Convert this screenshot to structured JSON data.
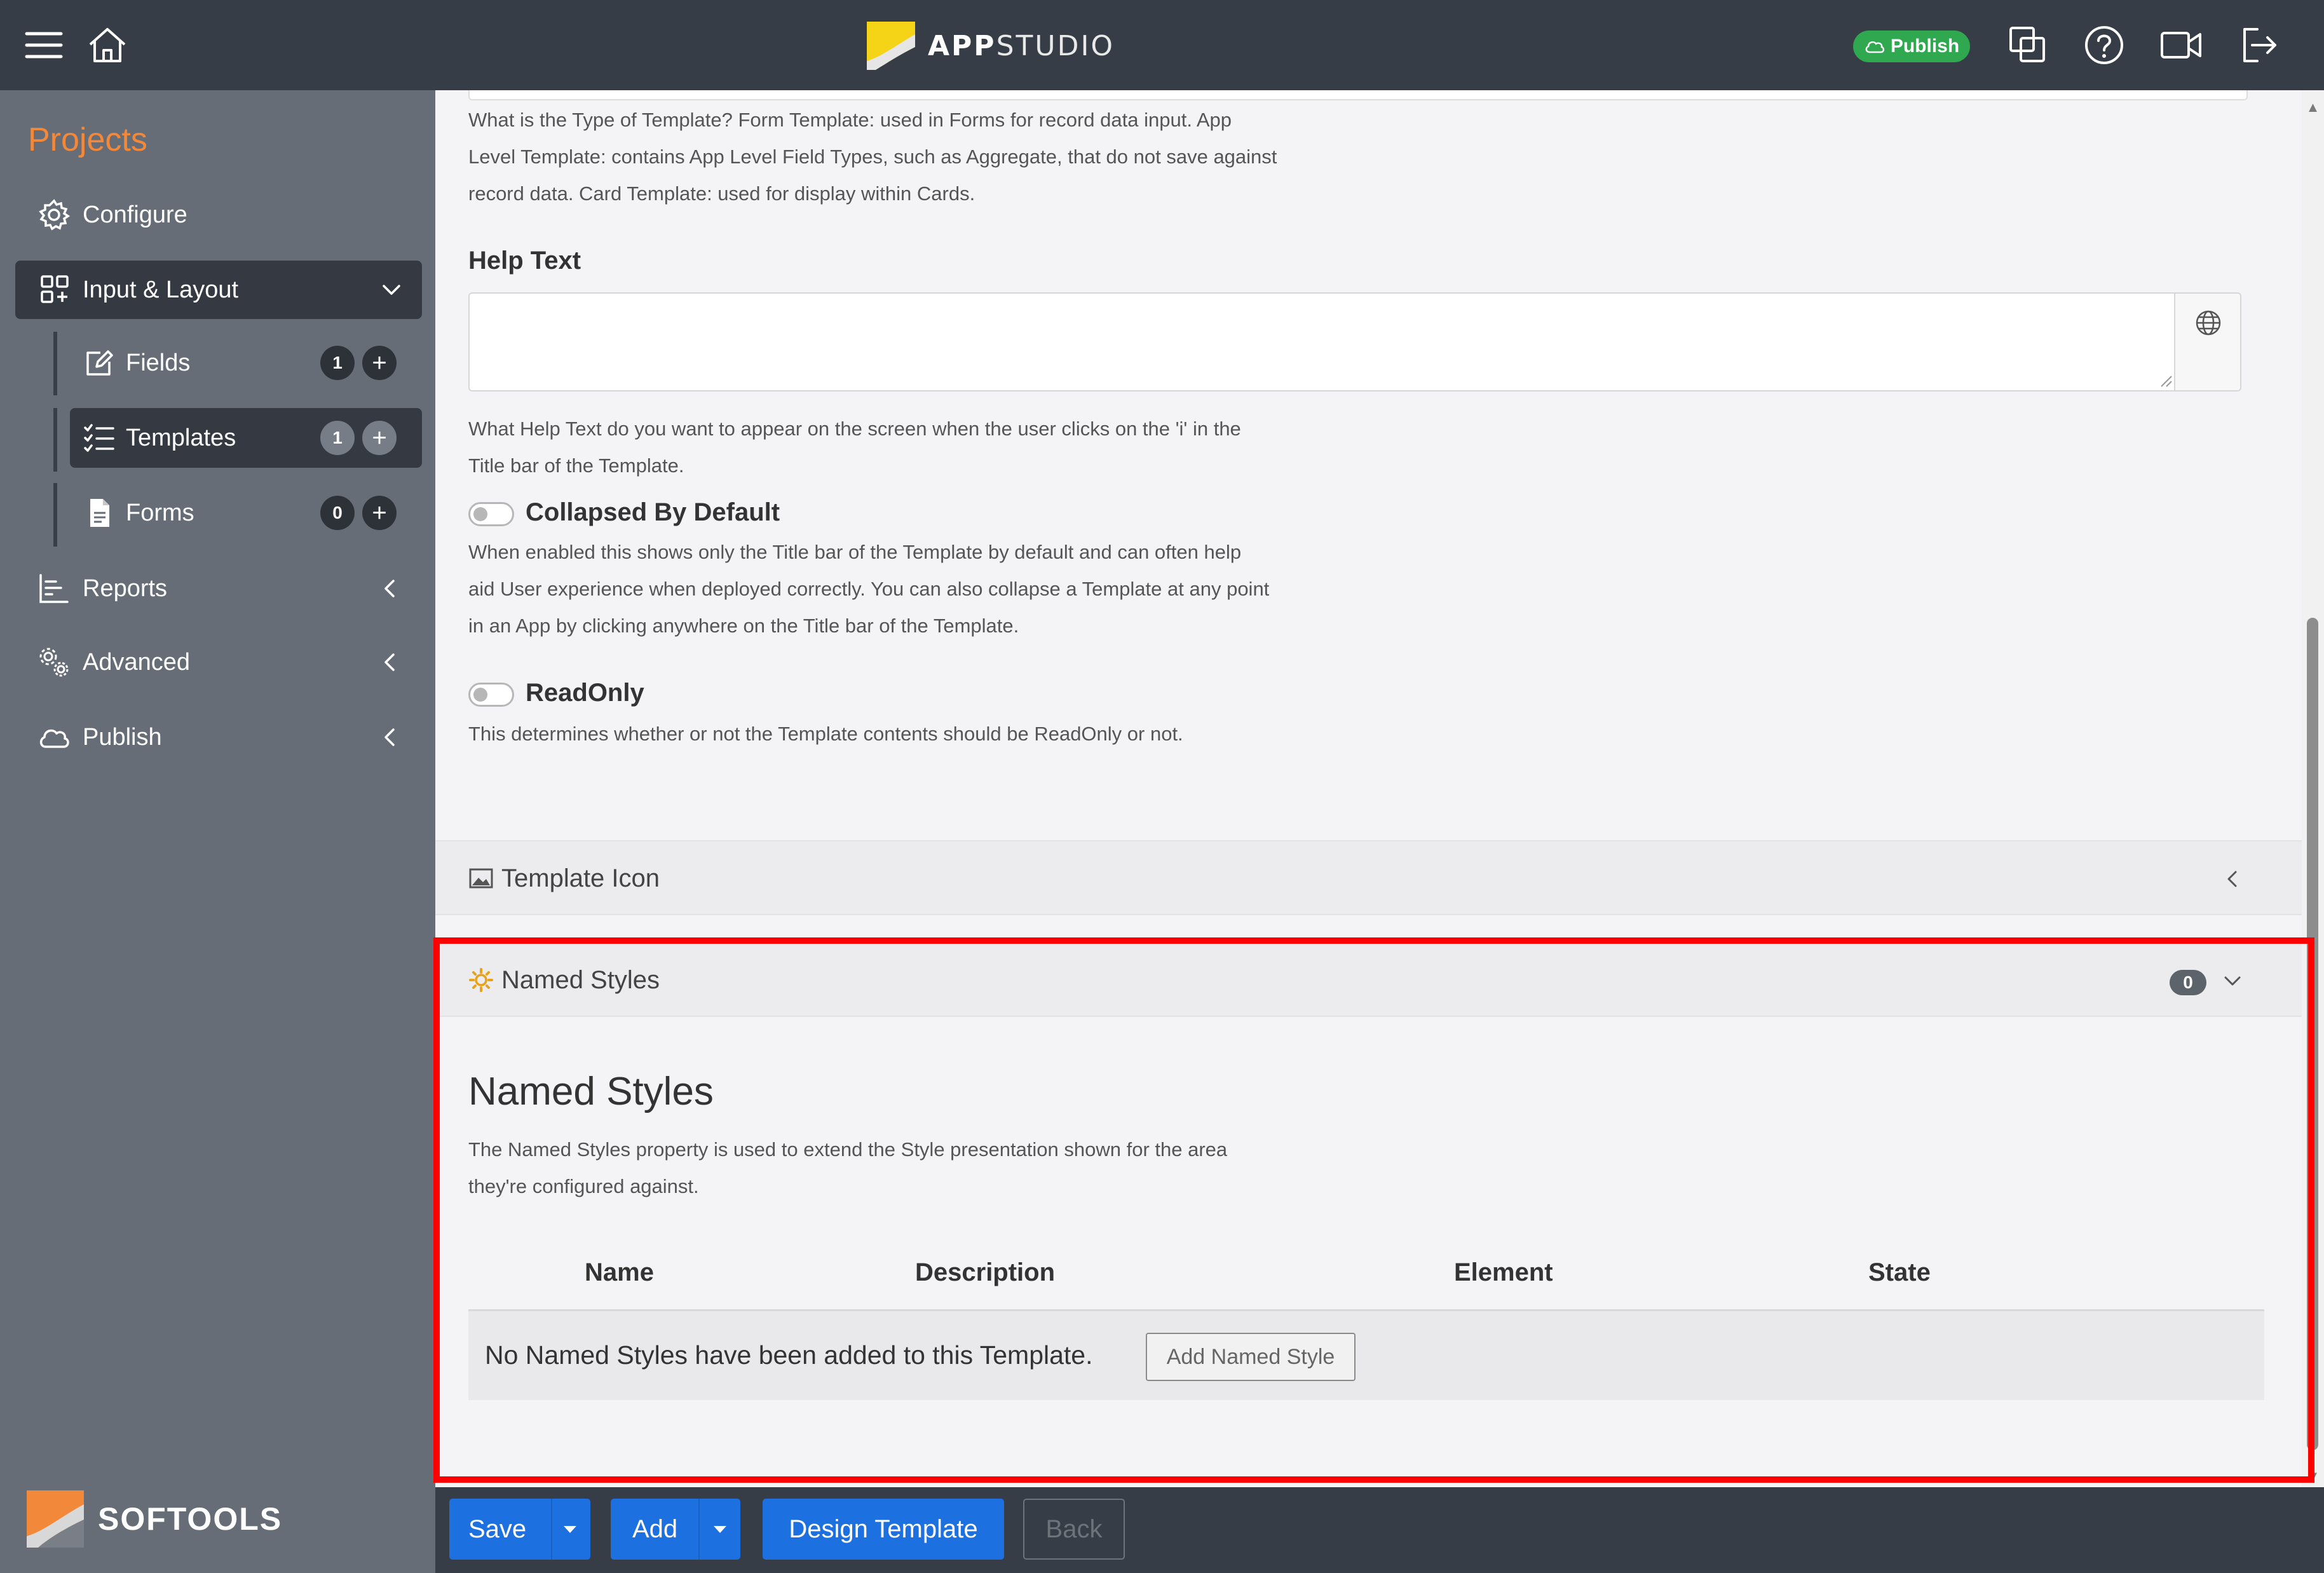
{
  "app": {
    "logo_bold": "APP",
    "logo_light": "STUDIO",
    "publish_label": "Publish",
    "accent_color": "#f2883a",
    "primary_button_color": "#1d70df",
    "success_color": "#2fa84f"
  },
  "sidebar": {
    "title": "Projects",
    "items": [
      {
        "label": "Configure",
        "icon": "gear-icon"
      },
      {
        "label": "Input & Layout",
        "icon": "layout-grid-icon",
        "expanded": true
      },
      {
        "label": "Reports",
        "icon": "reports-chart-icon"
      },
      {
        "label": "Advanced",
        "icon": "advanced-gears-icon"
      },
      {
        "label": "Publish",
        "icon": "cloud-icon"
      }
    ],
    "subitems": [
      {
        "label": "Fields",
        "count": "1",
        "icon": "edit-square-icon"
      },
      {
        "label": "Templates",
        "count": "1",
        "icon": "list-check-icon",
        "active": true
      },
      {
        "label": "Forms",
        "count": "0",
        "icon": "file-icon"
      }
    ],
    "plus": "+",
    "brand": "SOFTOOLS"
  },
  "content": {
    "type_help": [
      "What is the Type of Template? Form Template: used in Forms for record data input. App",
      "Level Template: contains App Level Field Types, such as Aggregate, that do not save against",
      "record data. Card Template: used for display within Cards."
    ],
    "help_text_label": "Help Text",
    "help_text_value": "",
    "help_text_help": [
      "What Help Text do you want to appear on the screen when the user clicks on the 'i' in the",
      "Title bar of the Template."
    ],
    "collapsed": {
      "label": "Collapsed By Default",
      "on": false,
      "help": [
        "When enabled this shows only the Title bar of the Template by default and can often help",
        "aid User experience when deployed correctly. You can also collapse a Template at any point",
        "in an App by clicking anywhere on the Title bar of the Template."
      ]
    },
    "readonly": {
      "label": "ReadOnly",
      "on": false,
      "help": "This determines whether or not the Template contents should be ReadOnly or not."
    },
    "template_icon_panel": "Template Icon",
    "named_styles_panel": "Named Styles",
    "named_styles_count": "0",
    "named_styles": {
      "heading": "Named Styles",
      "description": [
        "The Named Styles property is used to extend the Style presentation shown for the area",
        "they're configured against."
      ],
      "columns": [
        "Name",
        "Description",
        "Element",
        "State"
      ],
      "empty_message": "No Named Styles have been added to this Template.",
      "add_button": "Add Named Style"
    }
  },
  "bottom": {
    "save": "Save",
    "add": "Add",
    "design": "Design Template",
    "back": "Back"
  }
}
